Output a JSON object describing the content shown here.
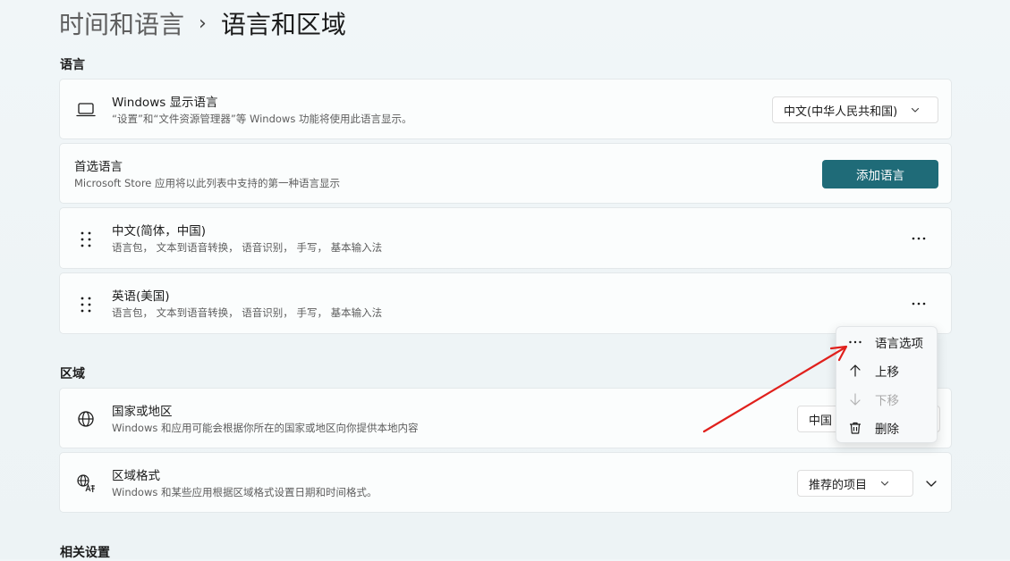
{
  "breadcrumb": {
    "parent": "时间和语言",
    "separator": "›",
    "current": "语言和区域"
  },
  "sections": {
    "language": "语言",
    "region": "区域",
    "related": "相关设置"
  },
  "display_language": {
    "title": "Windows 显示语言",
    "desc": "“设置”和“文件资源管理器”等 Windows 功能将使用此语言显示。",
    "value": "中文(中华人民共和国)"
  },
  "preferred": {
    "title": "首选语言",
    "desc": "Microsoft Store 应用将以此列表中支持的第一种语言显示",
    "button": "添加语言"
  },
  "languages": [
    {
      "name": "中文(简体，中国)",
      "features": "语言包， 文本到语音转换， 语音识别， 手写， 基本输入法"
    },
    {
      "name": "英语(美国)",
      "features": "语言包， 文本到语音转换， 语音识别， 手写， 基本输入法"
    }
  ],
  "country": {
    "title": "国家或地区",
    "desc": "Windows 和应用可能会根据你所在的国家或地区向你提供本地内容",
    "value": "中国"
  },
  "regional_format": {
    "title": "区域格式",
    "desc": "Windows 和某些应用根据区域格式设置日期和时间格式。",
    "value": "推荐的项目"
  },
  "context_menu": {
    "items": [
      {
        "label": "语言选项",
        "icon": "more-icon",
        "disabled": false
      },
      {
        "label": "上移",
        "icon": "arrow-up-icon",
        "disabled": false
      },
      {
        "label": "下移",
        "icon": "arrow-down-icon",
        "disabled": true
      },
      {
        "label": "删除",
        "icon": "trash-icon",
        "disabled": false
      }
    ]
  },
  "colors": {
    "accent": "#1f6b78",
    "annotation_arrow": "#e0201c"
  }
}
